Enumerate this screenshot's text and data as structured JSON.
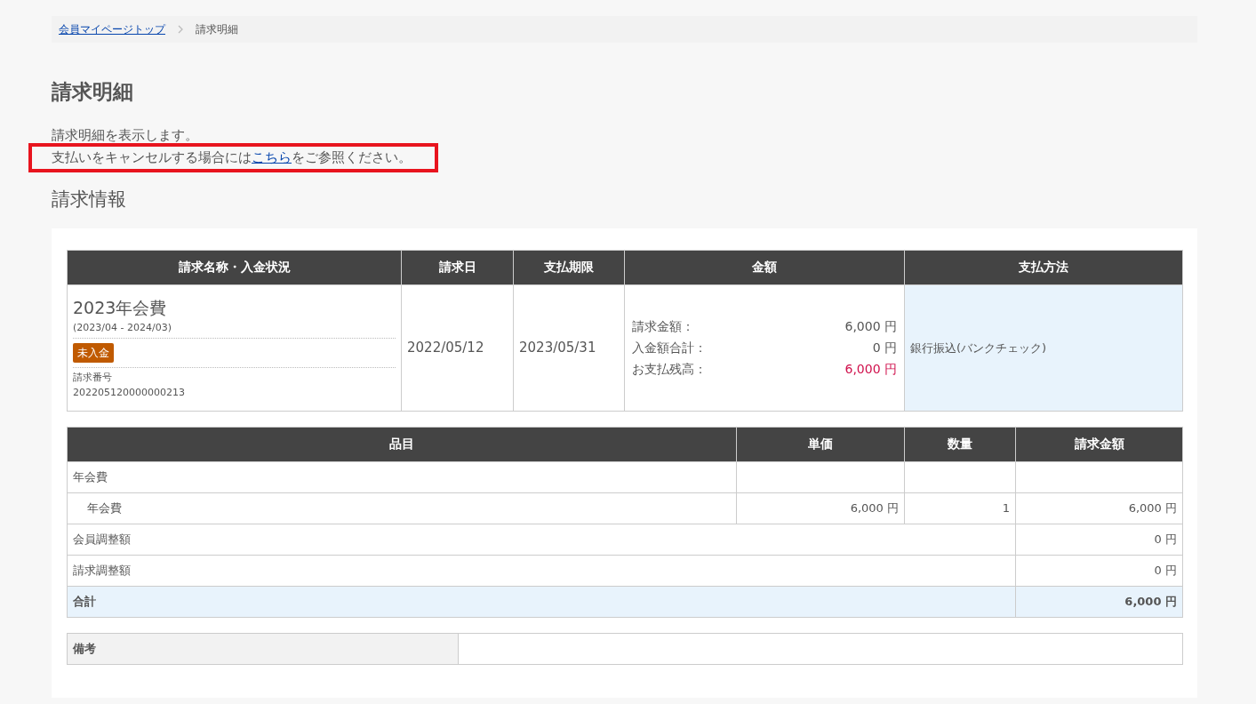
{
  "breadcrumb": [
    {
      "label": "会員マイページトップ",
      "link": true
    },
    {
      "label": "請求明細",
      "link": false
    }
  ],
  "title": "請求明細",
  "intro": {
    "line1": "請求明細を表示します。",
    "line2_before": "支払いをキャンセルする場合には",
    "line2_link": "こちら",
    "line2_after": "をご参照ください。",
    "highlighted": true
  },
  "section_title": "請求情報",
  "invoice_table": {
    "columns": [
      "請求名称・入金状況",
      "請求日",
      "支払期限",
      "金額",
      "支払方法"
    ],
    "row": {
      "name": "2023年会費",
      "period": "(2023/04 - 2024/03)",
      "status": {
        "label": "未入金",
        "color": "#c05a00"
      },
      "number_label": "請求番号",
      "number": "202205120000000213",
      "invoice_date": "2022/05/12",
      "due_date": "2023/05/31",
      "amounts": [
        {
          "label": "請求金額：",
          "value": "6,000 円",
          "emphasis": false
        },
        {
          "label": "入金額合計：",
          "value": "0 円",
          "emphasis": false
        },
        {
          "label": "お支払残高：",
          "value": "6,000 円",
          "emphasis": true
        }
      ],
      "payment_method": "銀行振込(バンクチェック)"
    }
  },
  "items_table": {
    "columns": [
      "品目",
      "単価",
      "数量",
      "請求金額"
    ],
    "rows": [
      {
        "kind": "group",
        "item": "年会費"
      },
      {
        "kind": "item",
        "item": "年会費",
        "unit_price": "6,000 円",
        "quantity": "1",
        "amount": "6,000 円"
      },
      {
        "kind": "adjustment",
        "item": "会員調整額",
        "amount": "0 円"
      },
      {
        "kind": "adjustment",
        "item": "請求調整額",
        "amount": "0 円"
      },
      {
        "kind": "total",
        "item": "合計",
        "amount": "6,000 円"
      }
    ]
  },
  "remarks": {
    "label": "備考"
  }
}
